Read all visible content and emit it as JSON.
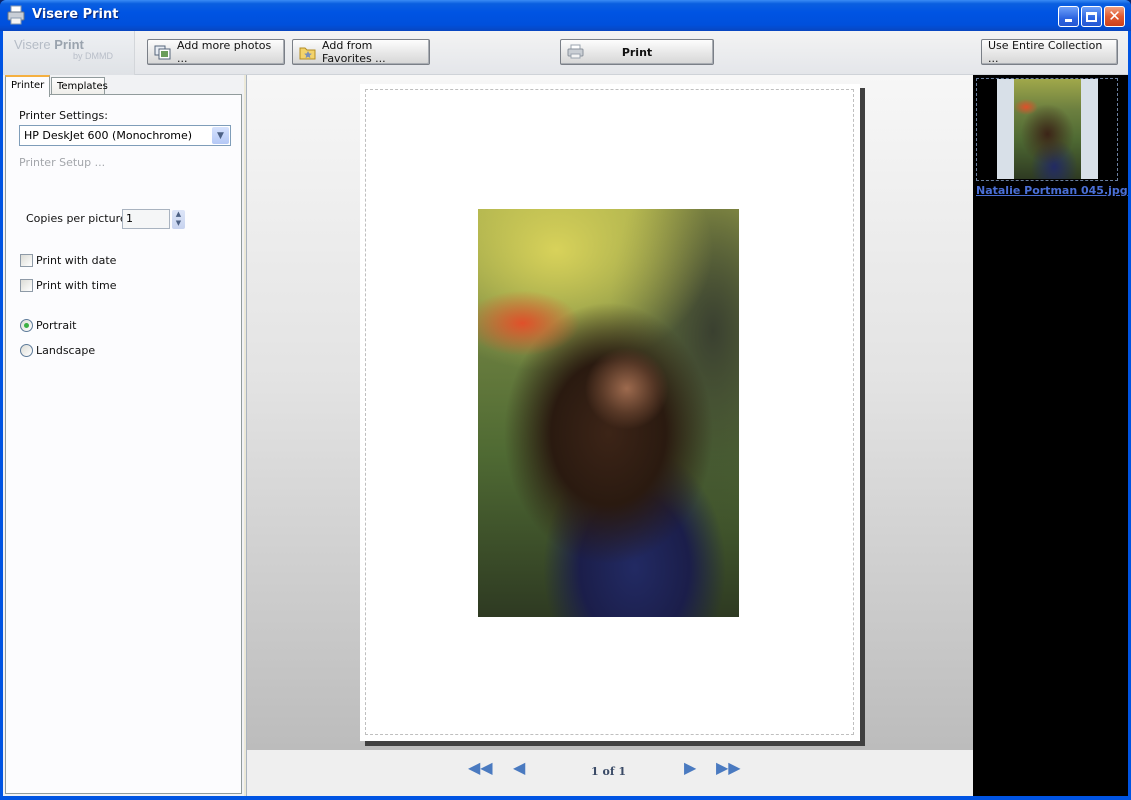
{
  "window": {
    "title": "Visere Print",
    "controls": {
      "minimize": "minimize",
      "maximize": "maximize",
      "close": "close"
    }
  },
  "toolbar": {
    "brand_name_light": "Visere",
    "brand_name_bold": "Print",
    "brand_by": "by DMMD",
    "add_photos_label": "Add more photos ...",
    "add_favorites_label": "Add from Favorites ...",
    "print_label": "Print",
    "use_collection_label": "Use Entire Collection ..."
  },
  "left_panel": {
    "tabs": [
      {
        "label": "Printer",
        "active": true
      },
      {
        "label": "Templates",
        "active": false
      }
    ],
    "printer_settings_label": "Printer Settings:",
    "printer_selected": "HP DeskJet 600 (Monochrome)",
    "printer_setup_link": "Printer Setup ...",
    "copies_label": "Copies per picture:",
    "copies_value": "1",
    "print_with_date": {
      "label": "Print with date",
      "checked": false
    },
    "print_with_time": {
      "label": "Print with time",
      "checked": false
    },
    "orientation": {
      "portrait": {
        "label": "Portrait",
        "selected": true
      },
      "landscape": {
        "label": "Landscape",
        "selected": false
      }
    }
  },
  "preview": {
    "photo_alt": "Portrait photo of a woman with long curly hair in a garden",
    "navigation": {
      "first": "◀◀",
      "prev": "◀",
      "next": "▶",
      "last": "▶▶",
      "page_count": "1 of 1"
    }
  },
  "collection": {
    "items": [
      {
        "filename": "Natalie Portman 045.jpg",
        "selected": true
      }
    ]
  }
}
